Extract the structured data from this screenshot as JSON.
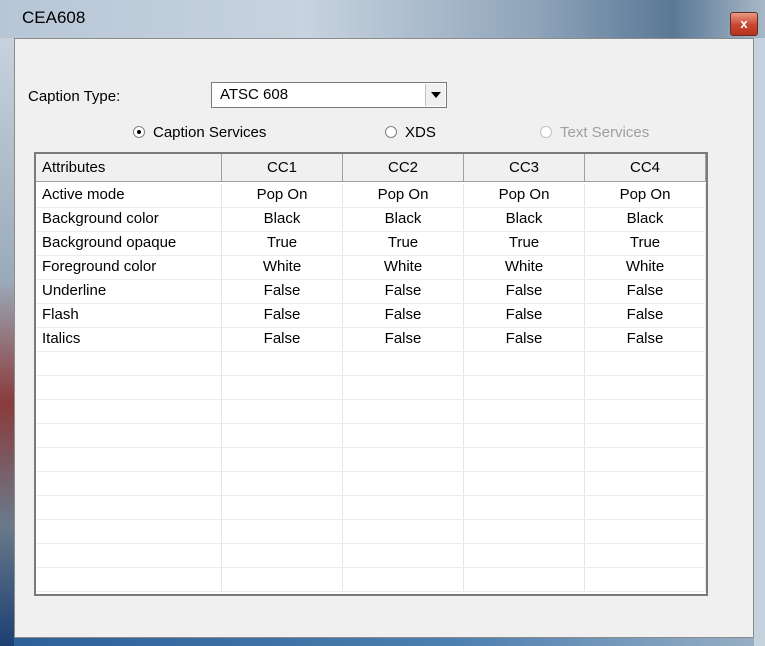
{
  "window": {
    "title": "CEA608",
    "close_glyph": "x"
  },
  "caption_type": {
    "label": "Caption Type:",
    "value": "ATSC 608"
  },
  "radios": [
    {
      "label": "Caption Services",
      "selected": true,
      "enabled": true
    },
    {
      "label": "XDS",
      "selected": false,
      "enabled": true
    },
    {
      "label": "Text Services",
      "selected": false,
      "enabled": false
    }
  ],
  "table": {
    "headers": [
      "Attributes",
      "CC1",
      "CC2",
      "CC3",
      "CC4"
    ],
    "rows": [
      [
        "Active mode",
        "Pop On",
        "Pop On",
        "Pop On",
        "Pop On"
      ],
      [
        "Background color",
        "Black",
        "Black",
        "Black",
        "Black"
      ],
      [
        "Background opaque",
        "True",
        "True",
        "True",
        "True"
      ],
      [
        "Foreground color",
        "White",
        "White",
        "White",
        "White"
      ],
      [
        "Underline",
        "False",
        "False",
        "False",
        "False"
      ],
      [
        "Flash",
        "False",
        "False",
        "False",
        "False"
      ],
      [
        "Italics",
        "False",
        "False",
        "False",
        "False"
      ]
    ]
  }
}
